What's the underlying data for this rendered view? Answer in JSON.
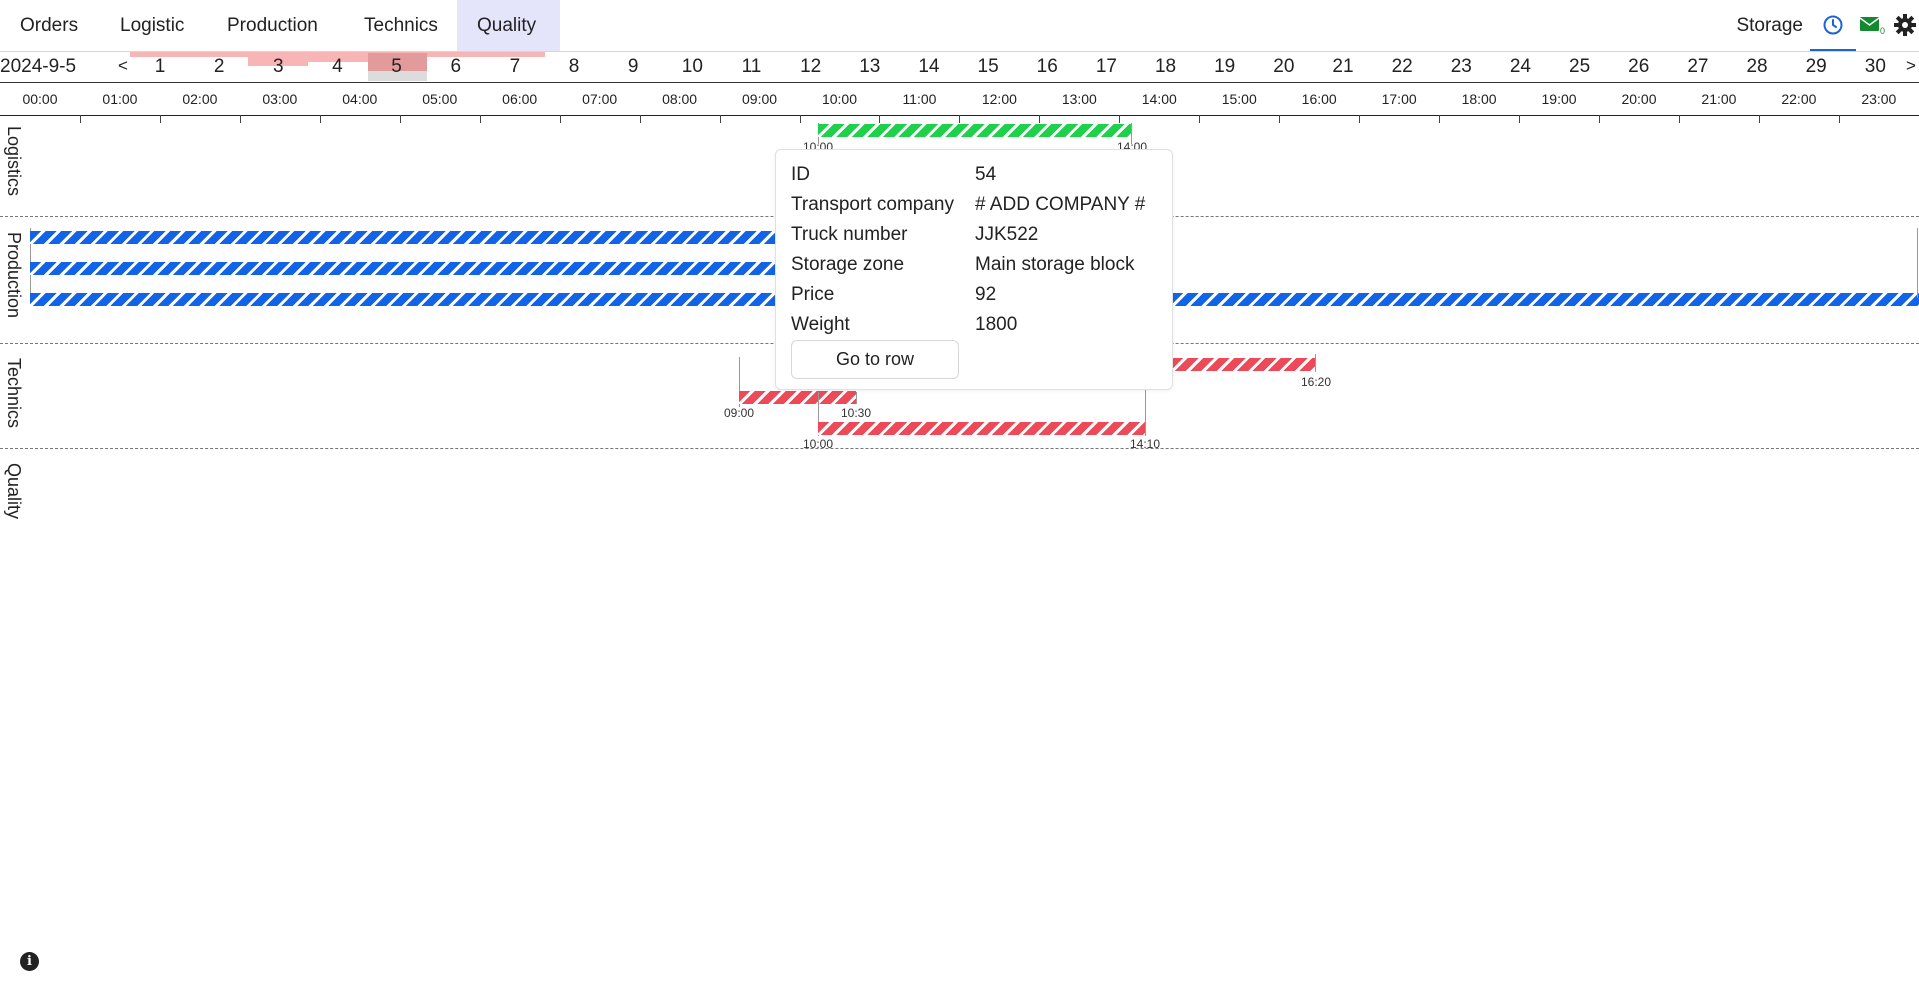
{
  "nav": {
    "items": [
      "Orders",
      "Logistic",
      "Production",
      "Technics",
      "Quality"
    ],
    "active": "Quality",
    "storage": "Storage"
  },
  "icons": {
    "clock": "clock-icon",
    "mail": "mail-icon",
    "mail_count": "0",
    "settings": "gear-icon",
    "info": "info-icon"
  },
  "colors": {
    "logistics": "#1fd14a",
    "production": "#1363e6",
    "technics": "#ec4a58",
    "active_tab": "#e4e4fb",
    "accent": "#1e63d6"
  },
  "calendar": {
    "date": "2024-9-5",
    "prev": "<",
    "next": ">",
    "days": [
      "1",
      "2",
      "3",
      "4",
      "5",
      "6",
      "7",
      "8",
      "9",
      "10",
      "11",
      "12",
      "13",
      "14",
      "15",
      "16",
      "17",
      "18",
      "19",
      "20",
      "21",
      "22",
      "23",
      "24",
      "25",
      "26",
      "27",
      "28",
      "29",
      "30"
    ],
    "selected_day": "5"
  },
  "hours": [
    "00:00",
    "01:00",
    "02:00",
    "03:00",
    "04:00",
    "05:00",
    "06:00",
    "07:00",
    "08:00",
    "09:00",
    "10:00",
    "11:00",
    "12:00",
    "13:00",
    "14:00",
    "15:00",
    "16:00",
    "17:00",
    "18:00",
    "19:00",
    "20:00",
    "21:00",
    "22:00",
    "23:00"
  ],
  "rows": [
    "Logistics",
    "Production",
    "Technics",
    "Quality"
  ],
  "timeline": {
    "logistics": {
      "start": "10:00",
      "end": "14:00"
    },
    "technics": [
      {
        "start": "09:00",
        "end": "10:30"
      },
      {
        "start": "10:00",
        "end": "14:10"
      },
      {
        "end": "16:20"
      }
    ]
  },
  "tooltip": {
    "rows": [
      {
        "key": "ID",
        "value": "54"
      },
      {
        "key": "Transport company",
        "value": "# ADD COMPANY #"
      },
      {
        "key": "Truck number",
        "value": "JJK522"
      },
      {
        "key": "Storage zone",
        "value": "Main storage block"
      },
      {
        "key": "Price",
        "value": "92"
      },
      {
        "key": "Weight",
        "value": "1800"
      }
    ],
    "button": "Go to row"
  }
}
